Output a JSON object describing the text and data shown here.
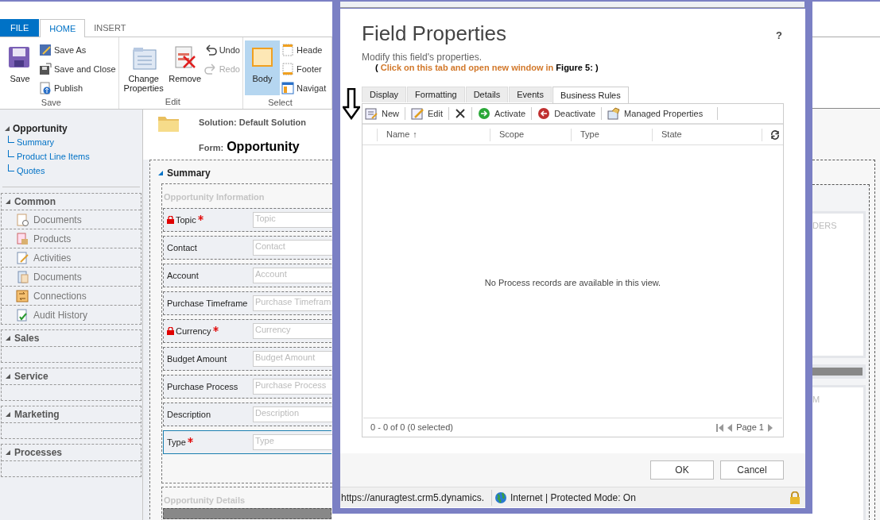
{
  "ribbon": {
    "tabs": [
      {
        "label": "FILE",
        "kind": "file",
        "selected": false
      },
      {
        "label": "HOME",
        "kind": "tab",
        "selected": true
      },
      {
        "label": "INSERT",
        "kind": "tab",
        "selected": false
      }
    ],
    "groups": [
      {
        "label": "Save",
        "large": [
          {
            "label": "Save",
            "selected": false
          }
        ],
        "small": [
          {
            "label": "Save As",
            "disabled": false
          },
          {
            "label": "Save and Close",
            "disabled": false
          },
          {
            "label": "Publish",
            "disabled": false
          }
        ]
      },
      {
        "label": "Edit",
        "large": [
          {
            "label": "Change Properties",
            "selected": false
          },
          {
            "label": "Remove",
            "selected": false
          }
        ],
        "small": [
          {
            "label": "Undo",
            "disabled": false
          },
          {
            "label": "Redo",
            "disabled": true
          }
        ]
      },
      {
        "label": "Select",
        "large": [
          {
            "label": "Body",
            "selected": true
          }
        ],
        "small": [
          {
            "label": "Heade",
            "disabled": false
          },
          {
            "label": "Footer",
            "disabled": false
          },
          {
            "label": "Navigat",
            "disabled": false
          }
        ]
      }
    ]
  },
  "nav": {
    "entity": {
      "label": "Opportunity",
      "expanded": true,
      "children": [
        {
          "label": "Summary"
        },
        {
          "label": "Product Line Items"
        },
        {
          "label": "Quotes"
        }
      ]
    },
    "groups": [
      {
        "label": "Common",
        "expanded": true,
        "items": [
          {
            "label": "Documents"
          },
          {
            "label": "Products"
          },
          {
            "label": "Activities"
          },
          {
            "label": "Documents"
          },
          {
            "label": "Connections"
          },
          {
            "label": "Audit History"
          }
        ]
      },
      {
        "label": "Sales",
        "expanded": true
      },
      {
        "label": "Service",
        "expanded": true
      },
      {
        "label": "Marketing",
        "expanded": true
      },
      {
        "label": "Processes",
        "expanded": true
      }
    ]
  },
  "form_header": {
    "solution": "Solution: Default Solution",
    "form_label": "Form:",
    "form_name": "Opportunity"
  },
  "section": {
    "title": "Summary",
    "expanded": true,
    "groups": [
      {
        "title": "Opportunity Information",
        "fields": [
          {
            "label": "Topic",
            "placeholder": "Topic",
            "required": true,
            "locked": true,
            "selected": false
          },
          {
            "label": "Contact",
            "placeholder": "Contact",
            "required": false,
            "locked": false,
            "selected": false
          },
          {
            "label": "Account",
            "placeholder": "Account",
            "required": false,
            "locked": false,
            "selected": false
          },
          {
            "label": "Purchase Timeframe",
            "placeholder": "Purchase Timefram",
            "required": false,
            "locked": false,
            "selected": false
          },
          {
            "label": "Currency",
            "placeholder": "Currency",
            "required": true,
            "locked": true,
            "selected": false
          },
          {
            "label": "Budget Amount",
            "placeholder": "Budget Amount",
            "required": false,
            "locked": false,
            "selected": false
          },
          {
            "label": "Purchase Process",
            "placeholder": "Purchase Process",
            "required": false,
            "locked": false,
            "selected": false
          },
          {
            "label": "Description",
            "placeholder": "Description",
            "required": false,
            "locked": false,
            "selected": false
          },
          {
            "label": "Type",
            "placeholder": "Type",
            "required": true,
            "locked": false,
            "selected": true
          }
        ]
      },
      {
        "title": "Opportunity Details"
      }
    ]
  },
  "dialog": {
    "title": "Field Properties",
    "help": "?",
    "description": "Modify this field's properties.",
    "annotation": {
      "open": "(",
      "highlight": "Click on this tab and open new window in",
      "reference": "Figure 5:",
      "close": ")"
    },
    "tabs": [
      {
        "label": "Display",
        "selected": false
      },
      {
        "label": "Formatting",
        "selected": false
      },
      {
        "label": "Details",
        "selected": false
      },
      {
        "label": "Events",
        "selected": false
      },
      {
        "label": "Business Rules",
        "selected": true
      }
    ],
    "toolbar": [
      {
        "kind": "button",
        "label": "New"
      },
      {
        "kind": "button",
        "label": "Edit"
      },
      {
        "kind": "delete"
      },
      {
        "kind": "button",
        "label": "Activate"
      },
      {
        "kind": "button",
        "label": "Deactivate"
      },
      {
        "kind": "button",
        "label": "Managed Properties"
      }
    ],
    "grid": {
      "columns": [
        {
          "label": "Name",
          "sorted": true
        },
        {
          "label": "Scope",
          "sorted": false
        },
        {
          "label": "Type",
          "sorted": false
        },
        {
          "label": "State",
          "sorted": false
        }
      ],
      "sort_mark": "↑",
      "empty_message": "No Process records are available in this view.",
      "count": "0 - 0 of 0 (0 selected)",
      "page": "Page 1"
    },
    "buttons": [
      "OK",
      "Cancel"
    ]
  },
  "status_bar": {
    "url": "https://anuragtest.crm5.dynamics.",
    "zone": "Internet | Protected Mode: On"
  },
  "right_panels": [
    {
      "label": "DERS"
    },
    {
      "label": "M"
    }
  ]
}
